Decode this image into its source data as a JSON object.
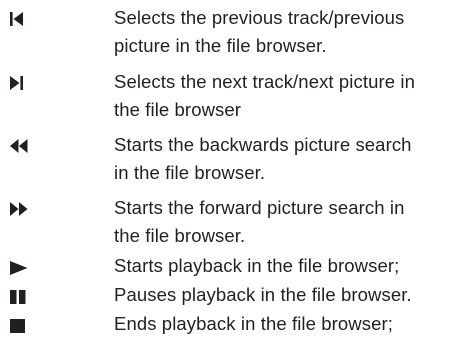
{
  "controls": [
    {
      "icon": "previous-track-icon",
      "lines": [
        "Selects the previous track/previous",
        "picture in the file browser."
      ]
    },
    {
      "icon": "next-track-icon",
      "lines": [
        "Selects the next track/next picture in",
        "the file browser"
      ]
    },
    {
      "icon": "fast-rewind-icon",
      "lines": [
        "Starts the backwards picture search",
        "in the file browser."
      ]
    },
    {
      "icon": "fast-forward-icon",
      "lines": [
        "Starts the forward picture search in",
        "the file browser."
      ]
    },
    {
      "icon": "play-icon",
      "lines": [
        "Starts playback in the file browser;"
      ]
    },
    {
      "icon": "pause-icon",
      "lines": [
        "Pauses playback in the file browser."
      ]
    },
    {
      "icon": "stop-icon",
      "lines": [
        "Ends playback in the file browser;"
      ]
    }
  ],
  "colors": {
    "text": "#231f20"
  }
}
